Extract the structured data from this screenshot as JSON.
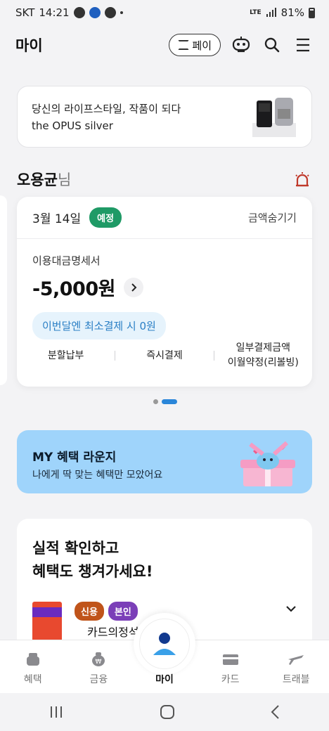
{
  "status_bar": {
    "carrier": "SKT",
    "time": "14:21",
    "network": "LTE",
    "battery": "81%"
  },
  "header": {
    "title": "마이",
    "pay_label": "페이"
  },
  "ad": {
    "line1": "당신의 라이프스타일, 작품이 되다",
    "line2": "the OPUS silver"
  },
  "greeting": {
    "name": "오용균",
    "suffix": "님"
  },
  "bill": {
    "date": "3월 14일",
    "badge": "예정",
    "hide_label": "금액숨기기",
    "label": "이용대금명세서",
    "amount": "-5,000원",
    "min_pay": "이번달엔 최소결제 시 0원",
    "actions": [
      {
        "label": "분할납부"
      },
      {
        "label": "즉시결제"
      },
      {
        "label": "일부결제금액\n이월약정(리볼빙)"
      }
    ]
  },
  "benefit": {
    "title": "MY 혜택 라운지",
    "subtitle": "나에게 딱 맞는 혜택만 모았어요"
  },
  "performance": {
    "title_line1": "실적 확인하고",
    "title_line2": "혜택도 챙겨가세요!",
    "tag_credit": "신용",
    "tag_self": "본인",
    "card_name": "카드의정석"
  },
  "bottom_nav": {
    "items": [
      {
        "label": "혜택"
      },
      {
        "label": "금융"
      },
      {
        "label": "마이"
      },
      {
        "label": "카드"
      },
      {
        "label": "트래블"
      }
    ]
  },
  "colors": {
    "accent_green": "#1f9a66",
    "accent_blue": "#2a86d9",
    "banner_blue": "#9fd4fb"
  }
}
